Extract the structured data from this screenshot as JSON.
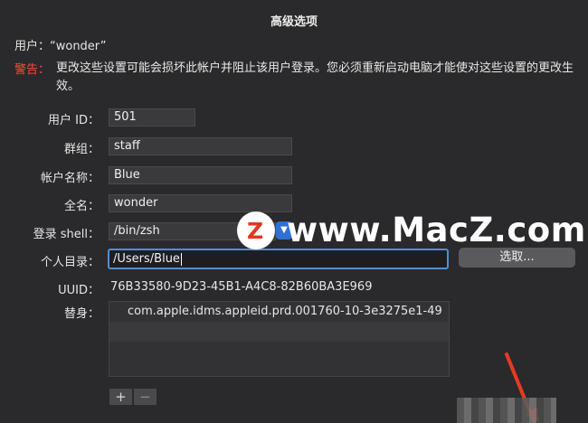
{
  "dialog": {
    "title": "高级选项",
    "user_line": "用户：“wonder”",
    "warning_label": "警告：",
    "warning_text": "更改这些设置可能会损坏此帐户并阻止该用户登录。您必须重新启动电脑才能使对这些设置的更改生效。"
  },
  "form": {
    "user_id": {
      "label": "用户 ID：",
      "value": "501"
    },
    "group": {
      "label": "群组：",
      "value": "staff"
    },
    "account_name": {
      "label": "帐户名称：",
      "value": "Blue"
    },
    "full_name": {
      "label": "全名：",
      "value": "wonder"
    },
    "login_shell": {
      "label": "登录 shell：",
      "value": "/bin/zsh"
    },
    "home_dir": {
      "label": "个人目录：",
      "value": "/Users/Blue"
    },
    "choose_button": "选取...",
    "uuid": {
      "label": "UUID：",
      "value": "76B33580-9D23-45B1-A4C8-82B60BA3E969"
    },
    "aliases": {
      "label": "替身：",
      "items": [
        "com.apple.idms.appleid.prd.001760-10-3e3275e1-49"
      ]
    },
    "add_label": "+",
    "remove_label": "−"
  },
  "watermark": {
    "badge": "Z",
    "text": "www.MacZ.com"
  },
  "colors": {
    "background": "#2a2a2c",
    "warning": "#ff4a3a",
    "accent": "#4d8fe0",
    "watermark_badge": "#e2371f"
  }
}
